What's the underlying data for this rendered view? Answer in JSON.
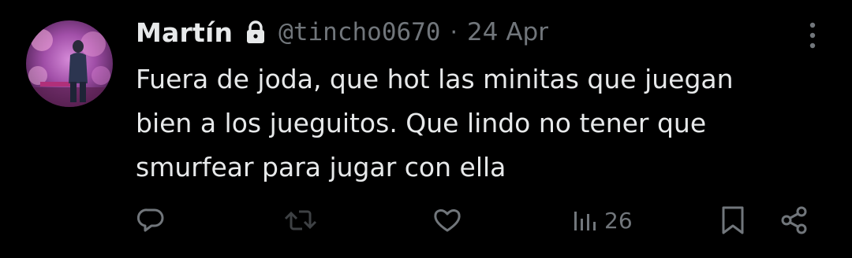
{
  "tweet": {
    "display_name": "Martín",
    "handle": "@tincho0670",
    "separator": "·",
    "date": "24 Apr",
    "body_lines": [
      "Fuera de joda, que hot las minitas que juegan",
      "bien a los jueguitos. Que lindo no tener que",
      "smurfear para jugar con ella"
    ],
    "views": "26"
  },
  "icons": {
    "lock": "lock-icon",
    "more": "more-vertical-icon",
    "reply": "reply-icon",
    "repost": "repost-icon",
    "like": "heart-icon",
    "views": "bar-chart-icon",
    "bookmark": "bookmark-icon",
    "share": "share-icon"
  },
  "colors": {
    "background": "#000000",
    "text_primary": "#e7e9ea",
    "text_secondary": "#71767b",
    "repost_disabled": "#3e4144"
  }
}
